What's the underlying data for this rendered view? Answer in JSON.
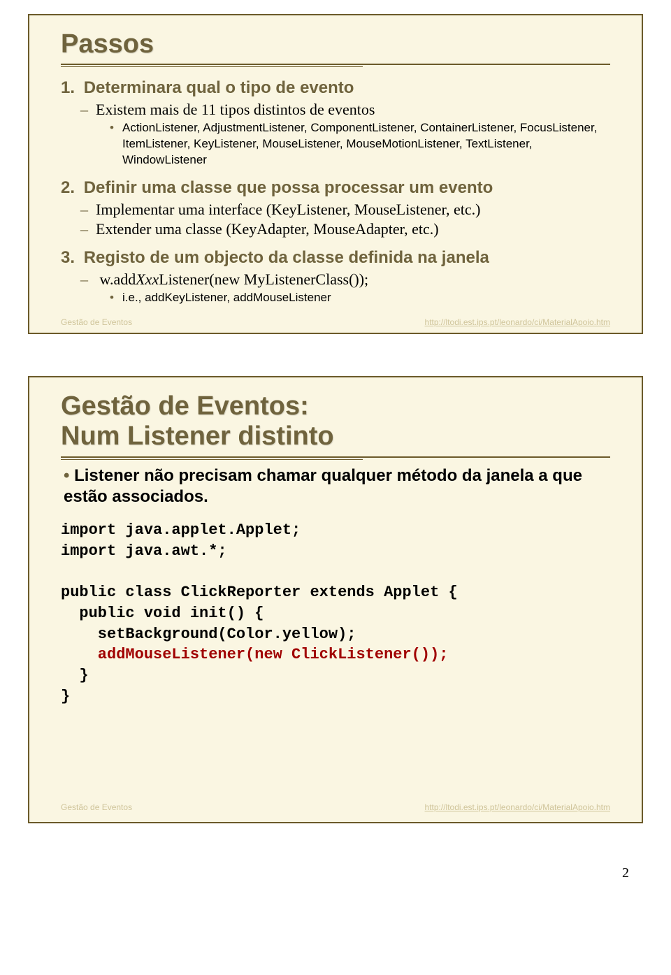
{
  "slide1": {
    "title": "Passos",
    "items": [
      {
        "num": "1.",
        "head": "Determinara qual o tipo de evento",
        "dashes": [
          {
            "text": "Existem mais de 11 tipos distintos de eventos",
            "subs": [
              "ActionListener, AdjustmentListener, ComponentListener, ContainerListener, FocusListener, ItemListener, KeyListener, MouseListener, MouseMotionListener, TextListener, WindowListener"
            ]
          }
        ]
      },
      {
        "num": "2.",
        "head": "Definir uma classe que possa processar um evento",
        "dashes": [
          {
            "text": "Implementar uma interface (KeyListener, MouseListener, etc.)"
          },
          {
            "text": "Extender uma classe (KeyAdapter, MouseAdapter, etc.)"
          }
        ]
      },
      {
        "num": "3.",
        "head": "Registo de um objecto da classe definida na janela",
        "dashes": [
          {
            "prefix": "w.add",
            "xxx": "Xxx",
            "suffix": "Listener(new MyListenerClass());",
            "subs": [
              "i.e., addKeyListener, addMouseListener"
            ]
          }
        ]
      }
    ],
    "footer_left": "Gestão de Eventos",
    "footer_right": "http://ltodi.est.ips.pt/leonardo/ci/MaterialApoio.htm"
  },
  "slide2": {
    "title_line1": "Gestão de Eventos:",
    "title_line2": "Num Listener distinto",
    "body": "Listener não precisam chamar qualquer método da janela a que estão associados.",
    "code": {
      "l1": "import java.applet.Applet;",
      "l2": "import java.awt.*;",
      "l3": "",
      "l4": "public class ClickReporter extends Applet {",
      "l5": "  public void init() {",
      "l6": "    setBackground(Color.yellow);",
      "l7_red": "    addMouseListener(new ClickListener());",
      "l8": "  }",
      "l9": "}"
    },
    "footer_left": "Gestão de Eventos",
    "footer_right": "http://ltodi.est.ips.pt/leonardo/ci/MaterialApoio.htm"
  },
  "page_number": "2"
}
